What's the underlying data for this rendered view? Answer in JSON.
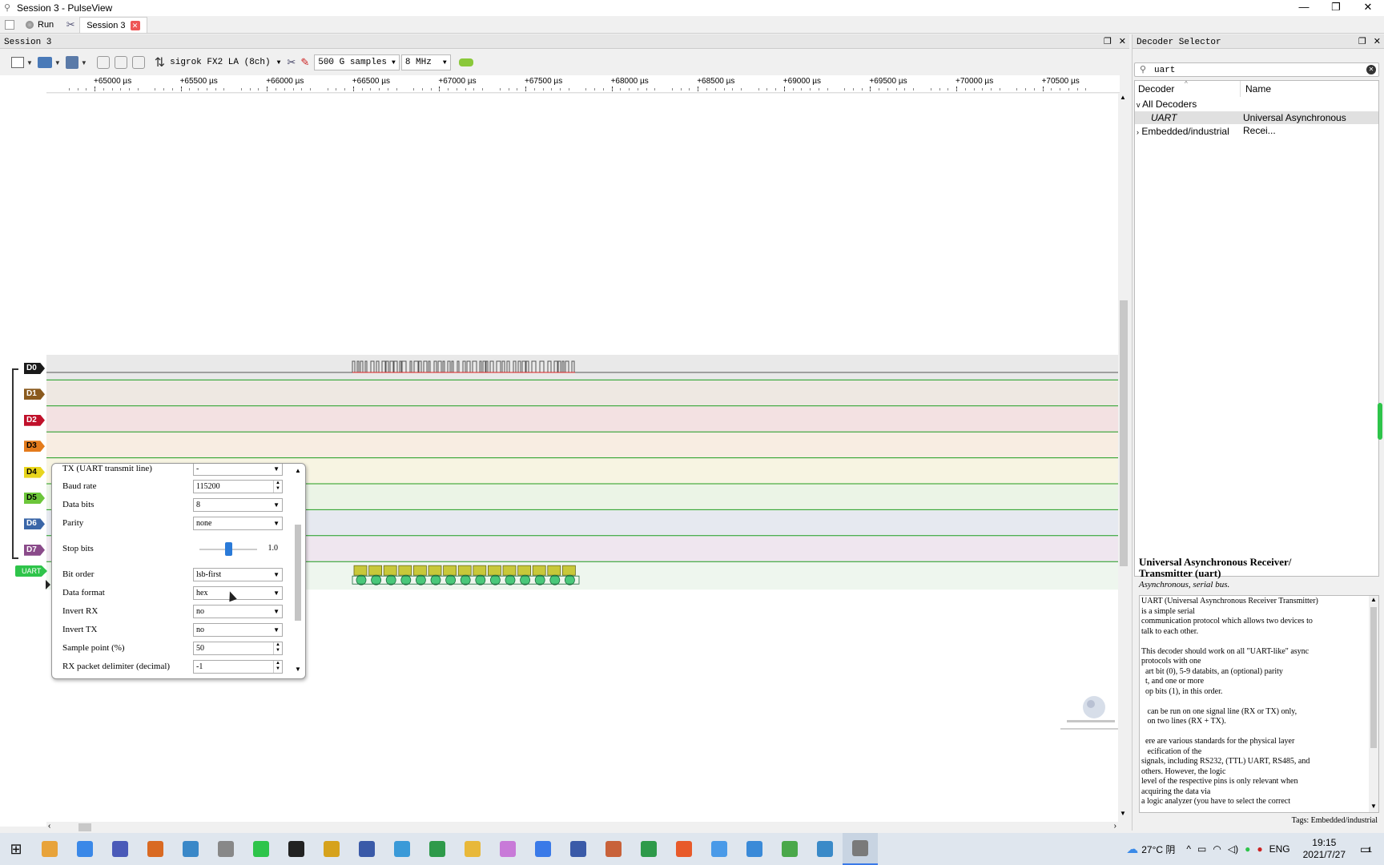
{
  "window": {
    "title": "Session 3 - PulseView",
    "controls": [
      "—",
      "❐",
      "✕"
    ]
  },
  "tabs": {
    "run_label": "Run",
    "session_tab_label": "Session 3"
  },
  "session_pane": {
    "title": "Session 3"
  },
  "toolbar": {
    "device": "sigrok FX2 LA (8ch)",
    "samples": "500 G samples",
    "samplerate": "8 MHz"
  },
  "ruler": {
    "ticks": [
      {
        "label": "+65000 µs"
      },
      {
        "label": "+65500 µs"
      },
      {
        "label": "+66000 µs"
      },
      {
        "label": "+66500 µs"
      },
      {
        "label": "+67000 µs"
      },
      {
        "label": "+67500 µs"
      },
      {
        "label": "+68000 µs"
      },
      {
        "label": "+68500 µs"
      },
      {
        "label": "+69000 µs"
      },
      {
        "label": "+69500 µs"
      },
      {
        "label": "+70000 µs"
      },
      {
        "label": "+70500 µs"
      }
    ]
  },
  "channels": [
    {
      "label": "D0",
      "color": "#1a1a1a",
      "bg": "#e9e9e9",
      "text": "#ffffff"
    },
    {
      "label": "D1",
      "color": "#8a5a1e",
      "bg": "#eee8e2",
      "text": "#ffffff"
    },
    {
      "label": "D2",
      "color": "#c0102a",
      "bg": "#f3e1e2",
      "text": "#ffffff"
    },
    {
      "label": "D3",
      "color": "#e47b1c",
      "bg": "#f8ede2",
      "text": "#000000"
    },
    {
      "label": "D4",
      "color": "#e8d51c",
      "bg": "#f7f4e2",
      "text": "#000000"
    },
    {
      "label": "D5",
      "color": "#6cc63a",
      "bg": "#ebf4e6",
      "text": "#000000"
    },
    {
      "label": "D6",
      "color": "#3a66a8",
      "bg": "#e6e9f0",
      "text": "#ffffff"
    },
    {
      "label": "D7",
      "color": "#8a4a8a",
      "bg": "#efe6ef",
      "text": "#ffffff"
    }
  ],
  "decoder_trace": {
    "label": "UART",
    "color": "#2ec44a"
  },
  "popup": {
    "rows": [
      {
        "label": "TX (UART transmit line)",
        "value": "-",
        "kind": "select"
      },
      {
        "label": "Baud rate",
        "value": "115200",
        "kind": "spin"
      },
      {
        "label": "Data bits",
        "value": "8",
        "kind": "select"
      },
      {
        "label": "Parity",
        "value": "none",
        "kind": "select"
      },
      {
        "label": "Stop bits",
        "value": "1.0",
        "kind": "slider",
        "level": 0.5
      },
      {
        "label": "Bit order",
        "value": "lsb-first",
        "kind": "select"
      },
      {
        "label": "Data format",
        "value": "hex",
        "kind": "select"
      },
      {
        "label": "Invert RX",
        "value": "no",
        "kind": "select"
      },
      {
        "label": "Invert TX",
        "value": "no",
        "kind": "select"
      },
      {
        "label": "Sample point (%)",
        "value": "50",
        "kind": "spin"
      },
      {
        "label": "RX packet delimiter (decimal)",
        "value": "-1",
        "kind": "spin"
      }
    ]
  },
  "decoder_selector": {
    "title": "Decoder Selector",
    "search_value": "uart",
    "col_decoder": "Decoder",
    "col_name": "Name",
    "group_all": "All Decoders",
    "item_decoder": "UART",
    "item_name": "Universal Asynchronous Recei...",
    "group_embedded": "Embedded/industrial",
    "desc_title": "Universal Asynchronous Receiver/\nTransmitter (uart)",
    "desc_subtitle": "Asynchronous, serial bus.",
    "desc_text": "UART (Universal Asynchronous Receiver Transmitter)\nis a simple serial\ncommunication protocol which allows two devices to\ntalk to each other.\n\nThis decoder should work on all \"UART-like\" async\nprotocols with one\n  art bit (0), 5-9 databits, an (optional) parity\n  t, and one or more\n  op bits (1), in this order.\n\n   can be run on one signal line (RX or TX) only,\n   on two lines (RX + TX).\n\n  ere are various standards for the physical layer\n   ecification of the\nsignals, including RS232, (TTL) UART, RS485, and\nothers. However, the logic\nlevel of the respective pins is only relevant when\nacquiring the data via\na logic analyzer (you have to select the correct",
    "tags": "Tags: Embedded/industrial"
  },
  "taskbar": {
    "apps": [
      "#e8a33a",
      "#3a88e8",
      "#4a5ab8",
      "#d96a22",
      "#3a88c8",
      "#888888",
      "#2ec44a",
      "#222222",
      "#d6a21c",
      "#3a5aa8",
      "#3a9ad8",
      "#2e9a4a",
      "#e8b83a",
      "#c87ad8",
      "#3a7ae8",
      "#3a5aa8",
      "#c8623a",
      "#2e9a4a",
      "#e85a2a",
      "#4a9ae8",
      "#3a8ad8",
      "#4aa84a",
      "#3a8ac8",
      "#7a7a7a"
    ],
    "weather": "27°C 阴",
    "lang": "ENG",
    "time": "19:15",
    "date": "2021/7/27",
    "notif_count": "1"
  }
}
